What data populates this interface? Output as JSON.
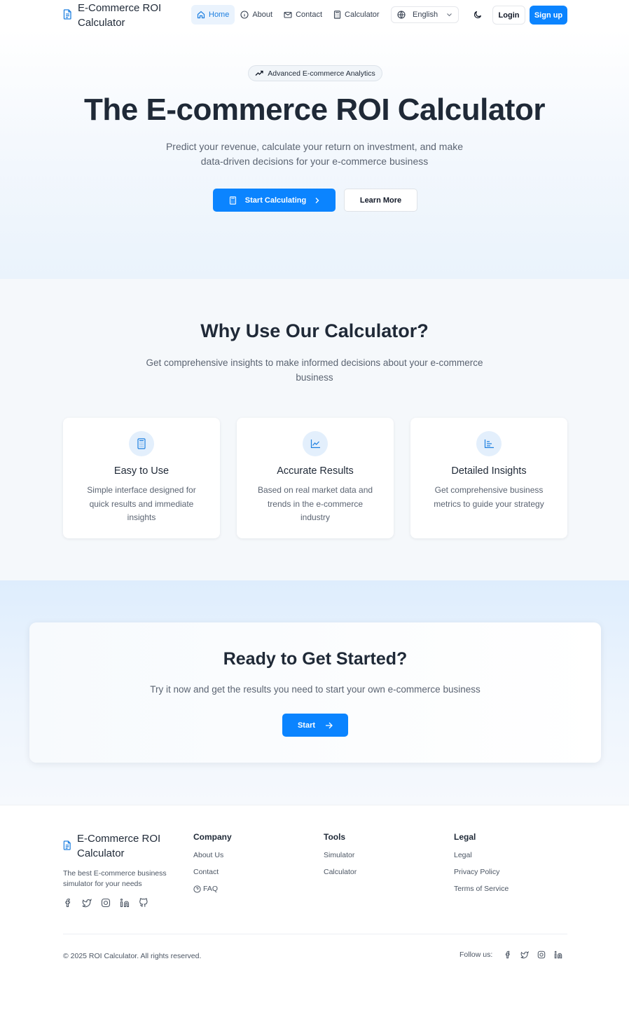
{
  "header": {
    "brand": "E-Commerce ROI Calculator",
    "nav": [
      {
        "label": "Home",
        "icon": "home-icon",
        "active": true
      },
      {
        "label": "About",
        "icon": "info-icon",
        "active": false
      },
      {
        "label": "Contact",
        "icon": "mail-icon",
        "active": false
      },
      {
        "label": "Calculator",
        "icon": "calculator-icon",
        "active": false
      }
    ],
    "language": "English",
    "login": "Login",
    "signup": "Sign up"
  },
  "hero": {
    "badge": "Advanced E-commerce Analytics",
    "title": "The E-commerce ROI Calculator",
    "subtitle": "Predict your revenue, calculate your return on investment, and make data-driven decisions for your e-commerce business",
    "primary_button": "Start Calculating",
    "secondary_button": "Learn More"
  },
  "features": {
    "title": "Why Use Our Calculator?",
    "subtitle": "Get comprehensive insights to make informed decisions about your e-commerce business",
    "cards": [
      {
        "title": "Easy to Use",
        "description": "Simple interface designed for quick results and immediate insights",
        "icon": "calculator-icon"
      },
      {
        "title": "Accurate Results",
        "description": "Based on real market data and trends in the e-commerce industry",
        "icon": "line-chart-icon"
      },
      {
        "title": "Detailed Insights",
        "description": "Get comprehensive business metrics to guide your strategy",
        "icon": "bar-chart-icon"
      }
    ]
  },
  "cta": {
    "title": "Ready to Get Started?",
    "subtitle": "Try it now and get the results you need to start your own e-commerce business",
    "button": "Start"
  },
  "footer": {
    "brand": "E-Commerce ROI Calculator",
    "tagline": "The best E-commerce business simulator for your needs",
    "columns": [
      {
        "title": "Company",
        "links": [
          "About Us",
          "Contact",
          "FAQ"
        ]
      },
      {
        "title": "Tools",
        "links": [
          "Simulator",
          "Calculator"
        ]
      },
      {
        "title": "Legal",
        "links": [
          "Legal",
          "Privacy Policy",
          "Terms of Service"
        ]
      }
    ],
    "copyright": "© 2025 ROI Calculator. All rights reserved.",
    "follow_label": "Follow us:"
  },
  "colors": {
    "primary": "#0b84ff",
    "text": "#1f2937",
    "muted": "#5b6472",
    "icon_bg": "#e3effc"
  }
}
